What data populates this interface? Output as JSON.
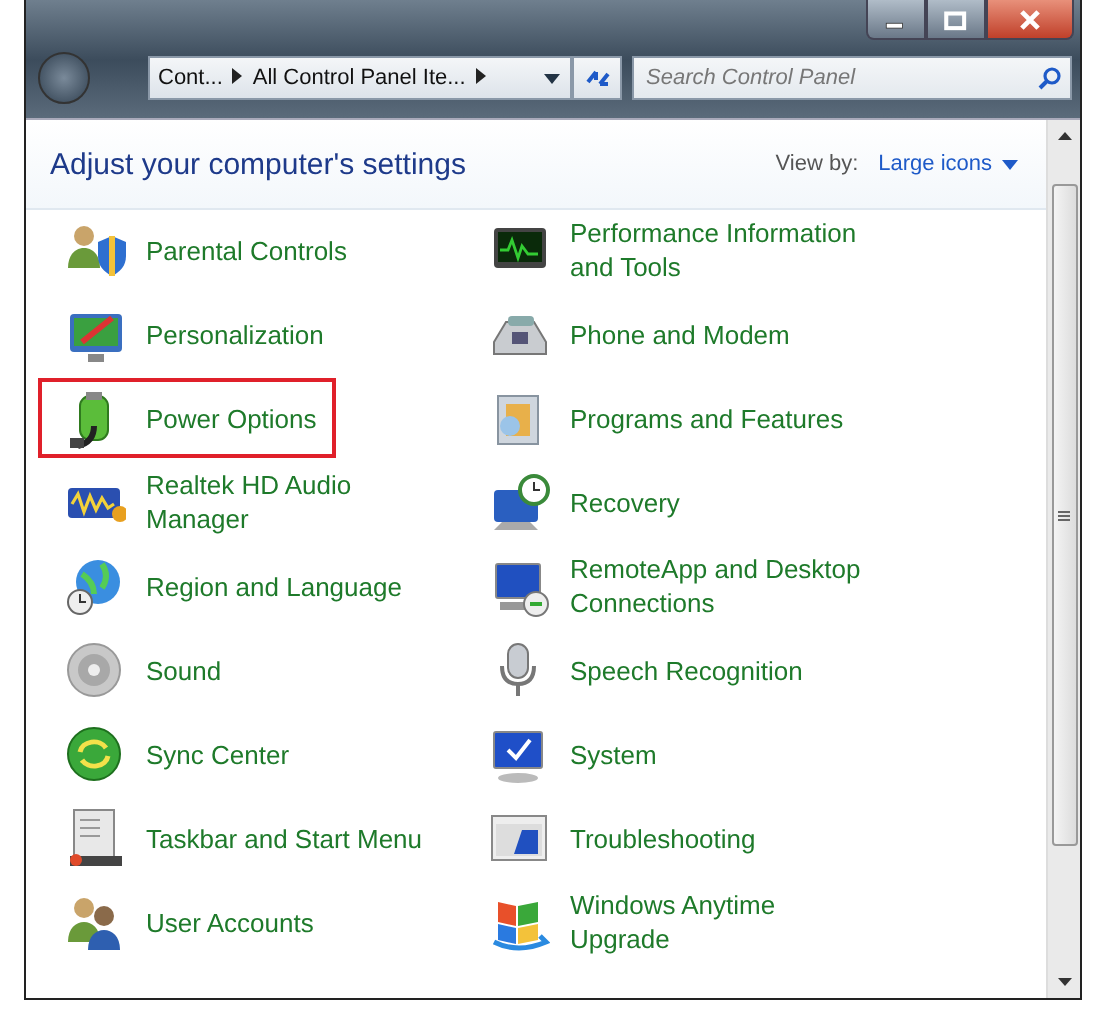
{
  "address_bar": {
    "breadcrumbs": [
      "Cont...",
      "All Control Panel Ite..."
    ]
  },
  "search": {
    "placeholder": "Search Control Panel"
  },
  "header": {
    "title": "Adjust your computer's settings",
    "view_by_label": "View by:",
    "view_by_value": "Large icons"
  },
  "items": [
    {
      "label": "Parental Controls",
      "highlighted": false
    },
    {
      "label": "Personalization",
      "highlighted": false
    },
    {
      "label": "Power Options",
      "highlighted": true
    },
    {
      "label": "Realtek HD Audio Manager",
      "highlighted": false
    },
    {
      "label": "Region and Language",
      "highlighted": false
    },
    {
      "label": "Sound",
      "highlighted": false
    },
    {
      "label": "Sync Center",
      "highlighted": false
    },
    {
      "label": "Taskbar and Start Menu",
      "highlighted": false
    },
    {
      "label": "User Accounts",
      "highlighted": false
    },
    {
      "label": "Performance Information and Tools",
      "highlighted": false
    },
    {
      "label": "Phone and Modem",
      "highlighted": false
    },
    {
      "label": "Programs and Features",
      "highlighted": false
    },
    {
      "label": "Recovery",
      "highlighted": false
    },
    {
      "label": "RemoteApp and Desktop Connections",
      "highlighted": false
    },
    {
      "label": "Speech Recognition",
      "highlighted": false
    },
    {
      "label": "System",
      "highlighted": false
    },
    {
      "label": "Troubleshooting",
      "highlighted": false
    },
    {
      "label": "Windows Anytime Upgrade",
      "highlighted": false
    }
  ]
}
